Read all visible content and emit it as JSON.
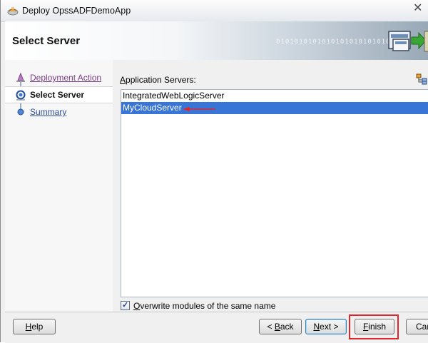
{
  "window": {
    "title": "Deploy OpssADFDemoApp",
    "close_glyph": "✕"
  },
  "header": {
    "title": "Select Server",
    "binary_text": "0101010101010101010101010",
    "art_icon": "server-deploy-icon"
  },
  "nav": {
    "items": [
      {
        "label": "Deployment Action",
        "state": "visited"
      },
      {
        "label": "Select Server",
        "state": "current"
      },
      {
        "label": "Summary",
        "state": "link"
      }
    ]
  },
  "content": {
    "list_label_prefix": "A",
    "list_label_rest": "pplication Servers:",
    "servers": [
      {
        "name": "IntegratedWebLogicServer",
        "selected": false
      },
      {
        "name": "MyCloudServer",
        "selected": true
      }
    ],
    "overwrite": {
      "checked": true,
      "label_prefix": "O",
      "label_rest": "verwrite modules of the same name"
    }
  },
  "footer": {
    "help_u": "H",
    "help_rest": "elp",
    "back_pre": "< ",
    "back_u": "B",
    "back_rest": "ack",
    "next_u": "N",
    "next_rest": "ext >",
    "finish_u": "F",
    "finish_rest": "inish",
    "cancel_label": "Cancel"
  },
  "colors": {
    "selection": "#3875d7",
    "annotation_red": "#e0262a",
    "link": "#2b4e9b",
    "visited": "#7b3d86"
  }
}
